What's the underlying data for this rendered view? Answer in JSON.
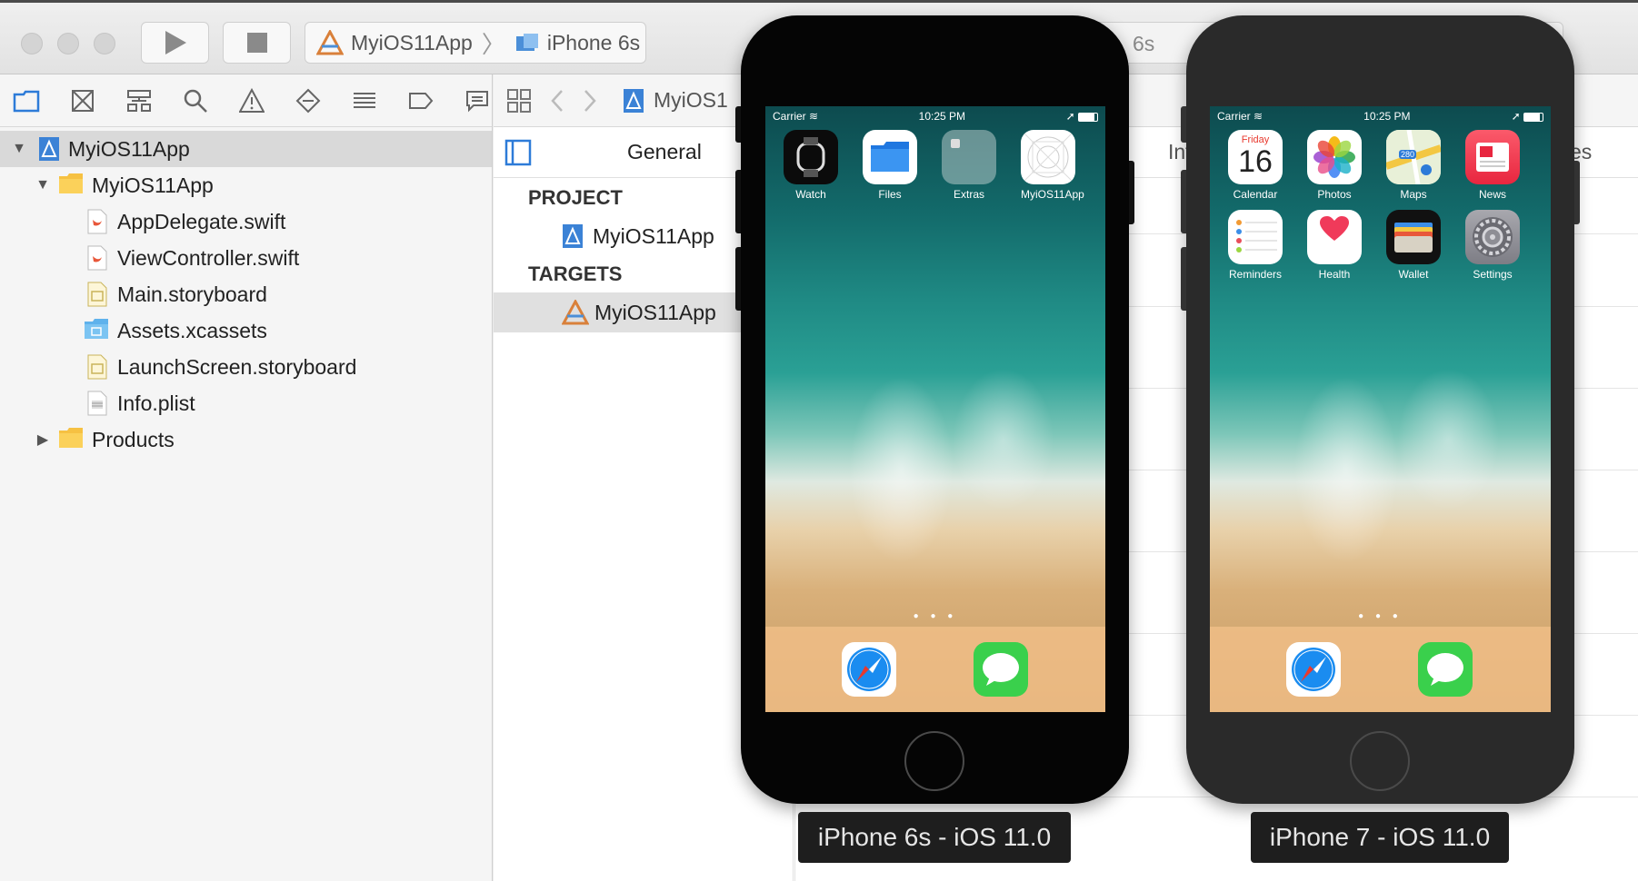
{
  "toolbar": {
    "scheme_app": "MyiOS11App",
    "scheme_device": "iPhone 6s",
    "activity_text": "6s"
  },
  "navigator": {
    "tree": [
      {
        "label": "MyiOS11App",
        "type": "project",
        "level": 0,
        "expanded": true,
        "selected": true
      },
      {
        "label": "MyiOS11App",
        "type": "folder",
        "level": 1,
        "expanded": true
      },
      {
        "label": "AppDelegate.swift",
        "type": "swift",
        "level": 2
      },
      {
        "label": "ViewController.swift",
        "type": "swift",
        "level": 2
      },
      {
        "label": "Main.storyboard",
        "type": "storyboard",
        "level": 2
      },
      {
        "label": "Assets.xcassets",
        "type": "assets",
        "level": 2
      },
      {
        "label": "LaunchScreen.storyboard",
        "type": "storyboard",
        "level": 2
      },
      {
        "label": "Info.plist",
        "type": "plist",
        "level": 2
      },
      {
        "label": "Products",
        "type": "folder",
        "level": 1,
        "expanded": false
      }
    ]
  },
  "editor": {
    "jumpbar_text": "MyiOS1",
    "general_tab": "General",
    "info_tab_fragment": "Inf",
    "right_tab_fragment": "es",
    "project_header": "PROJECT",
    "project_item": "MyiOS11App",
    "targets_header": "TARGETS",
    "target_item": "MyiOS11App"
  },
  "simulators": [
    {
      "label": "iPhone 6s - iOS 11.0",
      "carrier": "Carrier",
      "time": "10:25 PM",
      "apps": [
        {
          "label": "Watch",
          "icon": "watch-icon"
        },
        {
          "label": "Files",
          "icon": "files-icon"
        },
        {
          "label": "Extras",
          "icon": "extras-folder-icon"
        },
        {
          "label": "MyiOS11App",
          "icon": "blank-app-icon"
        }
      ],
      "dock": [
        "safari-icon",
        "messages-icon"
      ]
    },
    {
      "label": "iPhone 7 - iOS 11.0",
      "carrier": "Carrier",
      "time": "10:25 PM",
      "calendar_day": "Friday",
      "calendar_date": "16",
      "maps_badge": "280",
      "apps": [
        {
          "label": "Calendar",
          "icon": "calendar-icon"
        },
        {
          "label": "Photos",
          "icon": "photos-icon"
        },
        {
          "label": "Maps",
          "icon": "maps-icon"
        },
        {
          "label": "News",
          "icon": "news-icon"
        },
        {
          "label": "Reminders",
          "icon": "reminders-icon"
        },
        {
          "label": "Health",
          "icon": "health-icon"
        },
        {
          "label": "Wallet",
          "icon": "wallet-icon"
        },
        {
          "label": "Settings",
          "icon": "settings-icon"
        }
      ],
      "dock": [
        "safari-icon",
        "messages-icon"
      ]
    }
  ]
}
